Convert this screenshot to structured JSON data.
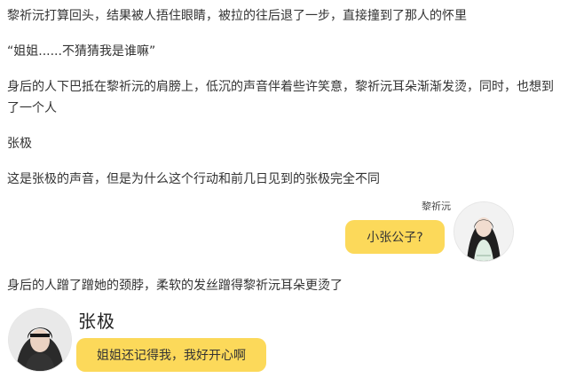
{
  "story": {
    "p1": "黎祈沅打算回头，结果被人捂住眼睛，被拉的往后退了一步，直接撞到了那人的怀里",
    "p2": "“姐姐......不猜猜我是谁嘛”",
    "p3": "身后的人下巴抵在黎祈沅的肩膀上，低沉的声音伴着些许笑意，黎祈沅耳朵渐渐发烫，同时，也想到了一个人",
    "p4": "张极",
    "p5": "这是张极的声音，但是为什么这个行动和前几日见到的张极完全不同",
    "p6": "身后的人蹭了蹭她的颈脖，柔软的发丝蹭得黎祈沅耳朵更烫了"
  },
  "chat_right": {
    "speaker": "黎祈沅",
    "message": "小张公子?",
    "avatar_icon": "girl-avatar-icon"
  },
  "chat_left": {
    "speaker": "张极",
    "message": "姐姐还记得我，我好开心啊",
    "avatar_icon": "boy-avatar-icon"
  },
  "colors": {
    "bubble": "#fcd95a",
    "text": "#333333"
  }
}
